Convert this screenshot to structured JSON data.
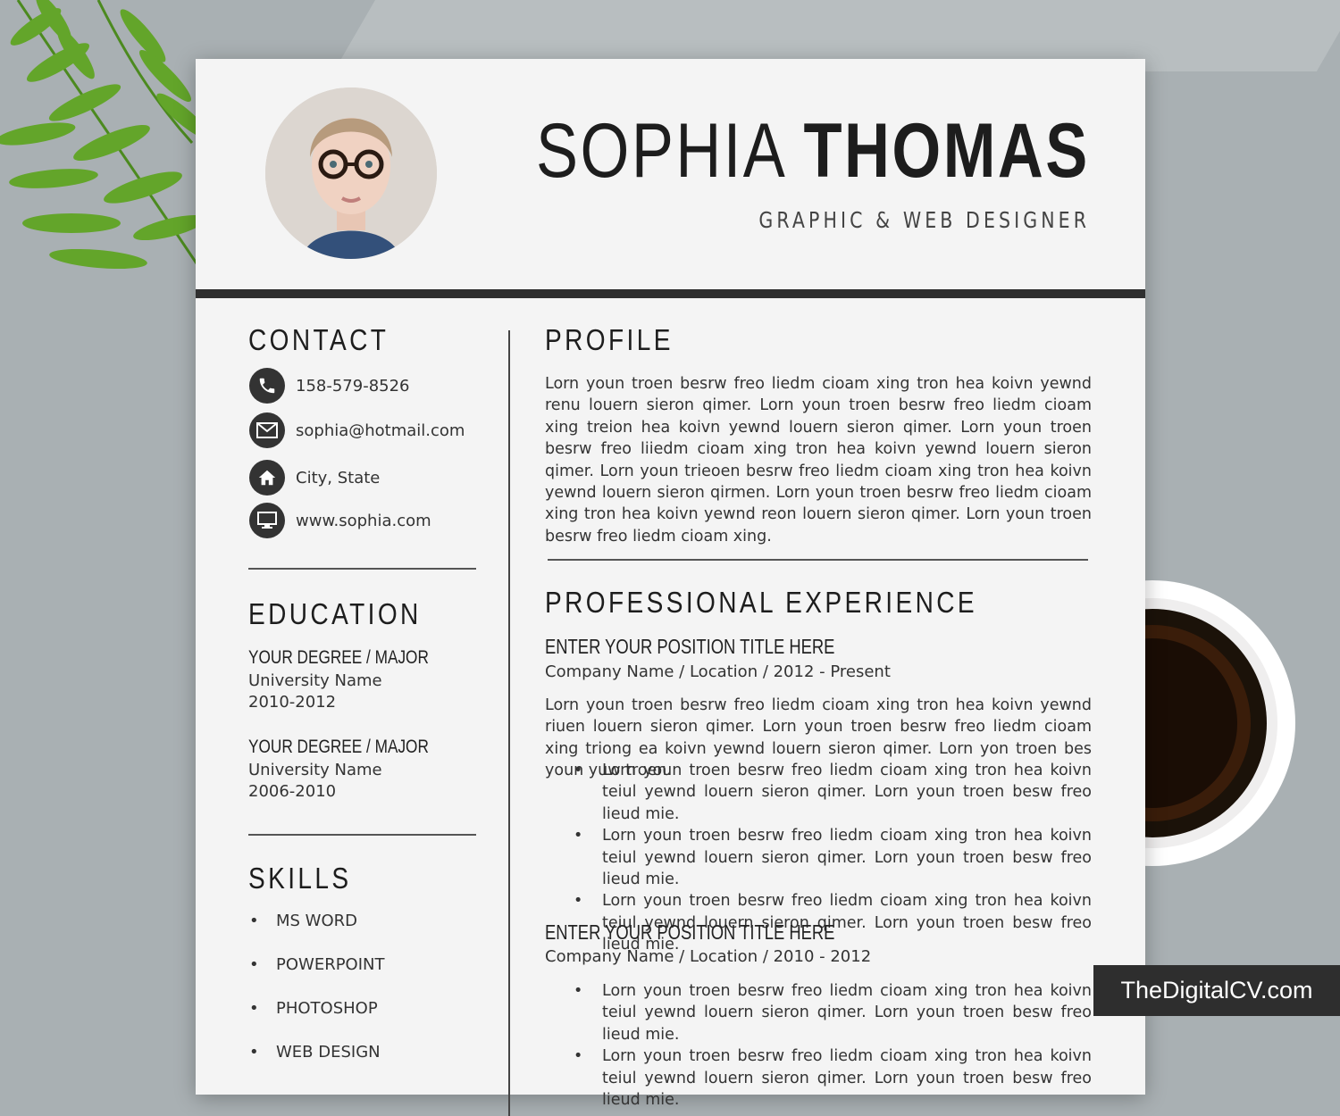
{
  "resume": {
    "first_name": "SOPHIA",
    "last_name": "THOMAS",
    "job_title": "GRAPHIC & WEB DESIGNER",
    "contact": {
      "heading": "CONTACT",
      "items": [
        {
          "icon": "phone-icon",
          "text": "158-579-8526"
        },
        {
          "icon": "mail-icon",
          "text": "sophia@hotmail.com"
        },
        {
          "icon": "home-icon",
          "text": "City, State"
        },
        {
          "icon": "monitor-icon",
          "text": "www.sophia.com"
        }
      ]
    },
    "education": {
      "heading": "EDUCATION",
      "entries": [
        {
          "degree": "YOUR DEGREE / MAJOR",
          "school": "University Name",
          "years": "2010-2012"
        },
        {
          "degree": "YOUR DEGREE / MAJOR",
          "school": "University Name",
          "years": "2006-2010"
        }
      ]
    },
    "skills": {
      "heading": "SKILLS",
      "items": [
        "MS WORD",
        "POWERPOINT",
        "PHOTOSHOP",
        "WEB DESIGN"
      ]
    },
    "profile": {
      "heading": "PROFILE",
      "text": "Lorn youn troen besrw freo liedm cioam xing tron hea koivn yewnd renu louern sieron qimer. Lorn youn troen besrw freo liedm cioam xing treion hea koivn yewnd louern sieron qimer. Lorn youn troen besrw freo liiedm cioam xing tron hea koivn yewnd louern sieron qimer. Lorn youn trieoen besrw freo liedm cioam xing tron hea koivn yewnd louern sieron qirmen. Lorn youn troen besrw freo liedm cioam xing tron hea koivn yewnd reon louern sieron qimer. Lorn youn troen besrw freo liedm cioam xing."
    },
    "experience": {
      "heading": "PROFESSIONAL EXPERIENCE",
      "jobs": [
        {
          "title": "ENTER YOUR POSITION TITLE HERE",
          "company": "Company Name / Location / 2012 - Present",
          "summary": "Lorn youn troen besrw freo liedm cioam xing tron hea koivn yewnd riuen louern sieron qimer. Lorn youn troen besrw freo liedm cioam xing triong ea koivn yewnd louern sieron qimer. Lorn yon troen bes youn yuw troen.",
          "bullets": [
            "Lorn youn troen besrw freo liedm cioam xing tron hea koivn teiul yewnd louern sieron qimer. Lorn youn troen besw freo lieud mie.",
            "Lorn youn troen besrw freo liedm cioam xing tron hea koivn teiul yewnd louern sieron qimer. Lorn youn troen besw freo lieud mie.",
            "Lorn youn troen besrw freo liedm cioam xing tron hea koivn teiul yewnd louern sieron qimer. Lorn youn troen besw freo lieud mie."
          ]
        },
        {
          "title": "ENTER YOUR POSITION TITLE HERE",
          "company": "Company Name / Location / 2010 - 2012",
          "bullets": [
            "Lorn youn troen besrw freo liedm cioam xing tron hea koivn teiul yewnd louern sieron qimer. Lorn youn troen besw freo lieud mie.",
            "Lorn youn troen besrw freo liedm cioam xing tron hea koivn teiul yewnd louern sieron qimer. Lorn youn troen besw freo lieud mie."
          ]
        }
      ]
    }
  },
  "badge": "TheDigitalCV.com",
  "colors": {
    "background": "#a9b0b3",
    "paper": "#f4f4f4",
    "ink": "#1d1d1d",
    "accent_bar": "#2f2f2f"
  }
}
